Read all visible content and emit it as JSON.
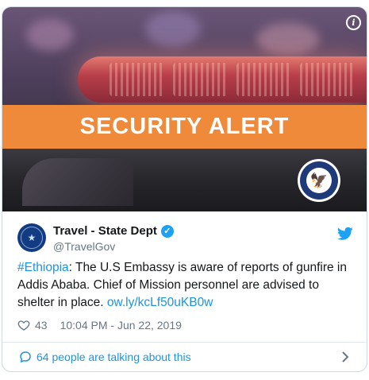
{
  "media": {
    "banner_text": "SECURITY ALERT",
    "info_icon": "info-icon",
    "seal_icon": "department-of-state-seal",
    "colors": {
      "banner": "#ef8a3a",
      "lightbar": "#b8404a"
    }
  },
  "tweet": {
    "display_name": "Travel - State Dept",
    "handle": "@TravelGov",
    "verified_icon": "verified-badge-icon",
    "platform_icon": "twitter-bird-icon",
    "text": {
      "hashtag": "#Ethiopia",
      "body": ": The U.S Embassy is aware of reports of gunfire in Addis Ababa. Chief of Mission personnel are advised to shelter in place. ",
      "link": "ow.ly/kcLf50uKB0w"
    },
    "likes": "43",
    "timestamp": "10:04 PM - Jun 22, 2019",
    "talking": "64 people are talking about this"
  },
  "colors": {
    "accent": "#1b95e0",
    "verified": "#1da1f2",
    "muted": "#657786"
  }
}
